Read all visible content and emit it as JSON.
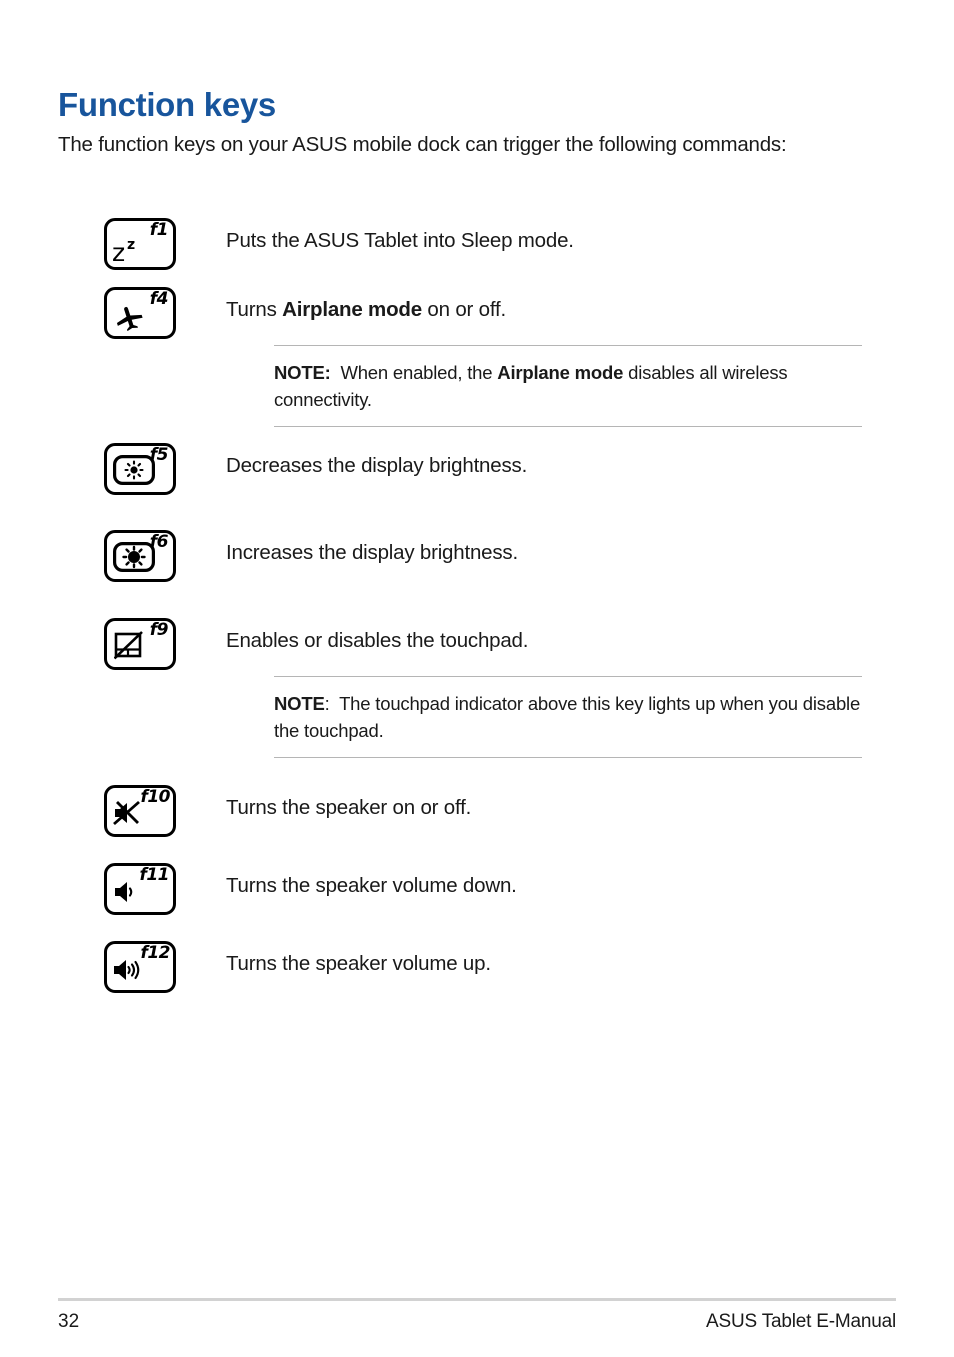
{
  "document": {
    "title": "Function keys",
    "intro": "The function keys on your ASUS mobile dock can trigger the following commands:",
    "heading_color": "#18559c"
  },
  "rows": [
    {
      "key": "f1",
      "icon": "sleep-zz-icon",
      "description_plain": "Puts the ASUS Tablet into Sleep mode.",
      "description_html": "Puts the ASUS Tablet into Sleep mode."
    },
    {
      "key": "f4",
      "icon": "airplane-icon",
      "description_plain": "Turns Airplane mode on or off.",
      "description_html": "Turns <b>Airplane mode</b> on or off."
    },
    {
      "key": "f5",
      "icon": "brightness-down-icon",
      "description_plain": "Decreases the display brightness.",
      "description_html": "Decreases the display brightness."
    },
    {
      "key": "f6",
      "icon": "brightness-up-icon",
      "description_plain": "Increases the display brightness.",
      "description_html": "Increases the display brightness."
    },
    {
      "key": "f9",
      "icon": "touchpad-disabled-icon",
      "description_plain": "Enables or disables the touchpad.",
      "description_html": "Enables or disables the touchpad."
    },
    {
      "key": "f10",
      "icon": "speaker-mute-icon",
      "description_plain": "Turns the speaker on or off.",
      "description_html": "Turns the speaker on or off."
    },
    {
      "key": "f11",
      "icon": "volume-down-icon",
      "description_plain": "Turns the speaker volume down.",
      "description_html": "Turns the speaker volume down."
    },
    {
      "key": "f12",
      "icon": "volume-up-icon",
      "description_plain": "Turns the speaker volume up.",
      "description_html": "Turns the speaker volume up."
    }
  ],
  "notes": [
    {
      "label": "NOTE:",
      "text_plain": "NOTE:  When enabled, the Airplane mode disables all wireless connectivity.",
      "text_html": "<b>NOTE:</b>&nbsp; When enabled, the <b>Airplane mode</b> disables all wireless connectivity."
    },
    {
      "label": "NOTE:",
      "text_plain": "NOTE:  The touchpad indicator above this key lights up when you disable the touchpad.",
      "text_html": "<b>NOTE</b>:&nbsp; The touchpad indicator above this key lights up when you disable the touchpad."
    }
  ],
  "footer": {
    "page_number": "32",
    "manual_title": "ASUS Tablet E-Manual"
  }
}
